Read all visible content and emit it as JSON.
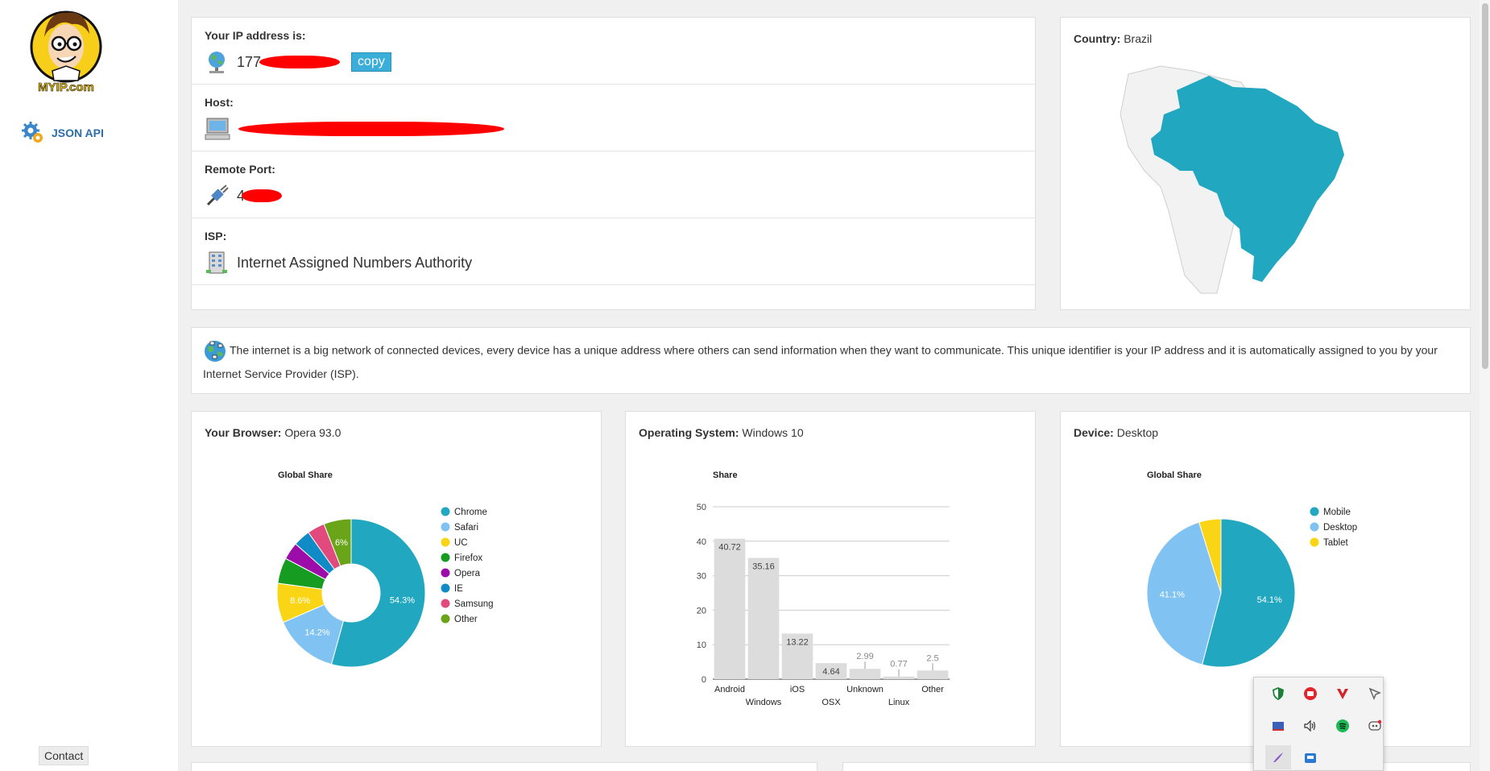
{
  "sidebar": {
    "logo_text": "MYIP.com",
    "json_api_label": "JSON API",
    "contact_label": "Contact"
  },
  "ip": {
    "ip_label": "Your IP address is:",
    "ip_value": "177",
    "copy_label": "copy",
    "host_label": "Host:",
    "port_label": "Remote Port:",
    "port_value": "4",
    "isp_label": "ISP:",
    "isp_value": "Internet Assigned Numbers Authority"
  },
  "country": {
    "label": "Country:",
    "value": "Brazil",
    "highlight_color": "#22a7c0"
  },
  "info_text": "The internet is a big network of connected devices, every device has a unique address where others can send information when they want to communicate. This unique identifier is your IP address and it is automatically assigned to you by your Internet Service Provider (ISP).",
  "browser": {
    "label": "Your Browser:",
    "value": "Opera 93.0"
  },
  "os": {
    "label": "Operating System:",
    "value": "Windows 10"
  },
  "device": {
    "label": "Device:",
    "value": "Desktop"
  },
  "chart_data": [
    {
      "type": "pie",
      "title": "Global Share",
      "donut": true,
      "categories": [
        "Chrome",
        "Safari",
        "UC",
        "Firefox",
        "Opera",
        "IE",
        "Samsung",
        "Other"
      ],
      "values": [
        54.3,
        14.2,
        8.6,
        5.6,
        3.8,
        3.7,
        3.8,
        6.0
      ],
      "labels": [
        "54.3%",
        "14.2%",
        "8.6%",
        "",
        "",
        "",
        "",
        "6%"
      ],
      "colors": [
        "#22a7c0",
        "#80c2f2",
        "#f9d515",
        "#179c22",
        "#9b0ca8",
        "#118bc5",
        "#e04a7d",
        "#6aa419"
      ],
      "legend": "right"
    },
    {
      "type": "bar",
      "title": "Share",
      "categories": [
        "Android",
        "Windows",
        "iOS",
        "OSX",
        "Unknown",
        "Linux",
        "Other"
      ],
      "values": [
        40.72,
        35.16,
        13.22,
        4.64,
        2.99,
        0.77,
        2.5
      ],
      "ylim": [
        0,
        50
      ],
      "yticks": [
        0,
        10,
        20,
        30,
        40,
        50
      ],
      "bar_color": "#dcdcdc",
      "grid": true
    },
    {
      "type": "pie",
      "title": "Global Share",
      "donut": false,
      "categories": [
        "Mobile",
        "Desktop",
        "Tablet"
      ],
      "values": [
        54.1,
        41.1,
        4.8
      ],
      "labels": [
        "54.1%",
        "41.1%",
        ""
      ],
      "colors": [
        "#22a7c0",
        "#80c2f2",
        "#f9d515"
      ],
      "legend": "right"
    }
  ],
  "tray_icons": [
    "shield-icon",
    "red-record-icon",
    "vivaldi-icon",
    "cursor-icon",
    "display-icon",
    "volume-icon",
    "spotify-icon",
    "discord-icon",
    "pen-icon",
    "bluetooth-icon"
  ]
}
